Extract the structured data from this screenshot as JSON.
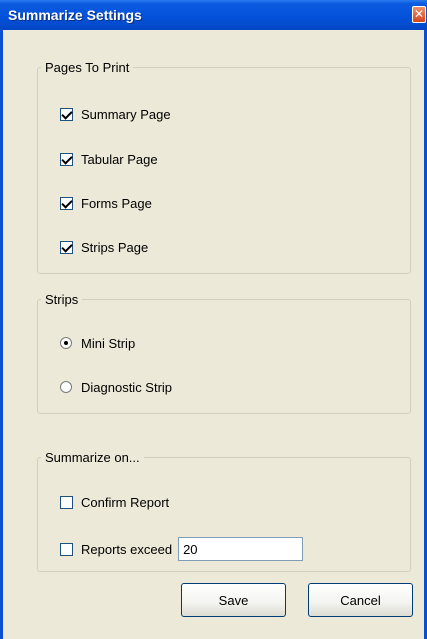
{
  "window": {
    "title": "Summarize Settings",
    "close_glyph": "✕"
  },
  "pages_group": {
    "legend": "Pages To Print",
    "items": [
      {
        "label": "Summary Page",
        "checked": true
      },
      {
        "label": "Tabular Page",
        "checked": true
      },
      {
        "label": "Forms Page",
        "checked": true
      },
      {
        "label": "Strips Page",
        "checked": true
      }
    ]
  },
  "strips_group": {
    "legend": "Strips",
    "items": [
      {
        "label": "Mini Strip",
        "selected": true
      },
      {
        "label": "Diagnostic Strip",
        "selected": false
      }
    ]
  },
  "summarize_group": {
    "legend": "Summarize on...",
    "confirm_label": "Confirm Report",
    "confirm_checked": false,
    "exceed_label": "Reports exceed",
    "exceed_checked": false,
    "exceed_value": "20"
  },
  "buttons": {
    "save": "Save",
    "cancel": "Cancel"
  },
  "colors": {
    "titlebar": "#0451d9",
    "face": "#ece9d8",
    "close": "#d6431c"
  }
}
